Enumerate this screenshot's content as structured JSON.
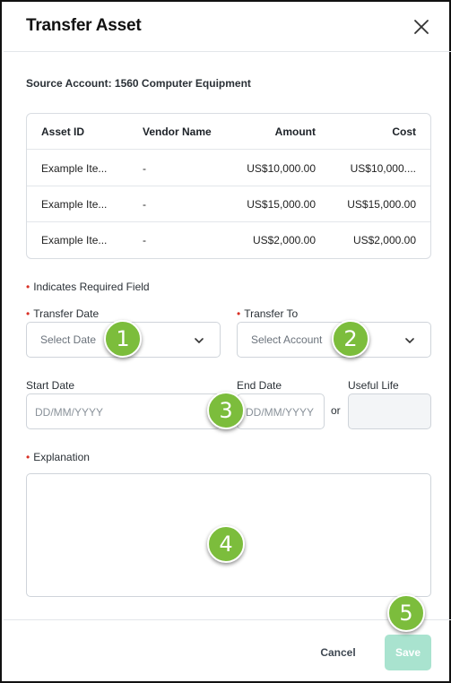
{
  "dialog": {
    "title": "Transfer Asset",
    "close_icon": "close-icon"
  },
  "source_account": "Source Account: 1560 Computer Equipment",
  "table": {
    "headers": [
      "Asset ID",
      "Vendor Name",
      "Amount",
      "Cost"
    ],
    "rows": [
      [
        "Example Ite...",
        "-",
        "US$10,000.00",
        "US$10,000...."
      ],
      [
        "Example Ite...",
        "-",
        "US$15,000.00",
        "US$15,000.00"
      ],
      [
        "Example Ite...",
        "-",
        "US$2,000.00",
        "US$2,000.00"
      ]
    ]
  },
  "required_note": "Indicates Required Field",
  "required_mark": "•",
  "form": {
    "transfer_date_label": "Transfer Date",
    "transfer_date_placeholder": "Select Date",
    "transfer_to_label": "Transfer To",
    "transfer_to_placeholder": "Select Account",
    "start_date_label": "Start Date",
    "start_date_placeholder": "DD/MM/YYYY",
    "end_date_label": "End Date",
    "end_date_placeholder": "DD/MM/YYYY",
    "or_text": "or",
    "useful_life_label": "Useful Life",
    "useful_life_value": "",
    "explanation_label": "Explanation",
    "explanation_value": ""
  },
  "footer": {
    "cancel_label": "Cancel",
    "save_label": "Save"
  },
  "callouts": [
    "1",
    "2",
    "3",
    "4",
    "5"
  ],
  "colors": {
    "required": "#d93025",
    "save_button": "#a9e3cf",
    "callout": "#7cbd3c"
  }
}
